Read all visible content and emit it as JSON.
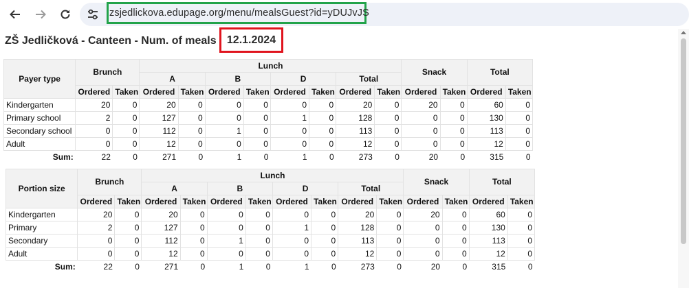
{
  "browser": {
    "url": "zsjedlickova.edupage.org/menu/mealsGuest?id=yDUJvJS",
    "back_icon": "arrow-left-icon",
    "forward_icon": "arrow-right-icon",
    "reload_icon": "reload-icon",
    "site_info_icon": "tune-icon"
  },
  "page": {
    "title": "ZŠ Jedličková - Canteen - Num. of meals",
    "date": "12.1.2024"
  },
  "headers": {
    "brunch": "Brunch",
    "lunch": "Lunch",
    "snack": "Snack",
    "total": "Total",
    "lunch_a": "A",
    "lunch_b": "B",
    "lunch_d": "D",
    "lunch_total": "Total",
    "ordered": "Ordered",
    "taken": "Taken",
    "sum": "Sum:"
  },
  "tables": [
    {
      "first_header": "Payer type",
      "rows": [
        {
          "label": "Kindergarten",
          "values": [
            "20",
            "0",
            "20",
            "0",
            "0",
            "0",
            "0",
            "0",
            "20",
            "0",
            "20",
            "0",
            "60",
            "0"
          ]
        },
        {
          "label": "Primary school",
          "values": [
            "2",
            "0",
            "127",
            "0",
            "0",
            "0",
            "1",
            "0",
            "128",
            "0",
            "0",
            "0",
            "130",
            "0"
          ]
        },
        {
          "label": "Secondary school",
          "values": [
            "0",
            "0",
            "112",
            "0",
            "1",
            "0",
            "0",
            "0",
            "113",
            "0",
            "0",
            "0",
            "113",
            "0"
          ]
        },
        {
          "label": "Adult",
          "values": [
            "0",
            "0",
            "12",
            "0",
            "0",
            "0",
            "0",
            "0",
            "12",
            "0",
            "0",
            "0",
            "12",
            "0"
          ]
        }
      ],
      "sum": [
        "22",
        "0",
        "271",
        "0",
        "1",
        "0",
        "1",
        "0",
        "273",
        "0",
        "20",
        "0",
        "315",
        "0"
      ]
    },
    {
      "first_header": "Portion size",
      "rows": [
        {
          "label": "Kindergarten",
          "values": [
            "20",
            "0",
            "20",
            "0",
            "0",
            "0",
            "0",
            "0",
            "20",
            "0",
            "20",
            "0",
            "60",
            "0"
          ]
        },
        {
          "label": "Primary",
          "values": [
            "2",
            "0",
            "127",
            "0",
            "0",
            "0",
            "1",
            "0",
            "128",
            "0",
            "0",
            "0",
            "130",
            "0"
          ]
        },
        {
          "label": "Secondary",
          "values": [
            "0",
            "0",
            "112",
            "0",
            "1",
            "0",
            "0",
            "0",
            "113",
            "0",
            "0",
            "0",
            "113",
            "0"
          ]
        },
        {
          "label": "Adult",
          "values": [
            "0",
            "0",
            "12",
            "0",
            "0",
            "0",
            "0",
            "0",
            "12",
            "0",
            "0",
            "0",
            "12",
            "0"
          ]
        }
      ],
      "sum": [
        "22",
        "0",
        "271",
        "0",
        "1",
        "0",
        "1",
        "0",
        "273",
        "0",
        "20",
        "0",
        "315",
        "0"
      ]
    }
  ]
}
